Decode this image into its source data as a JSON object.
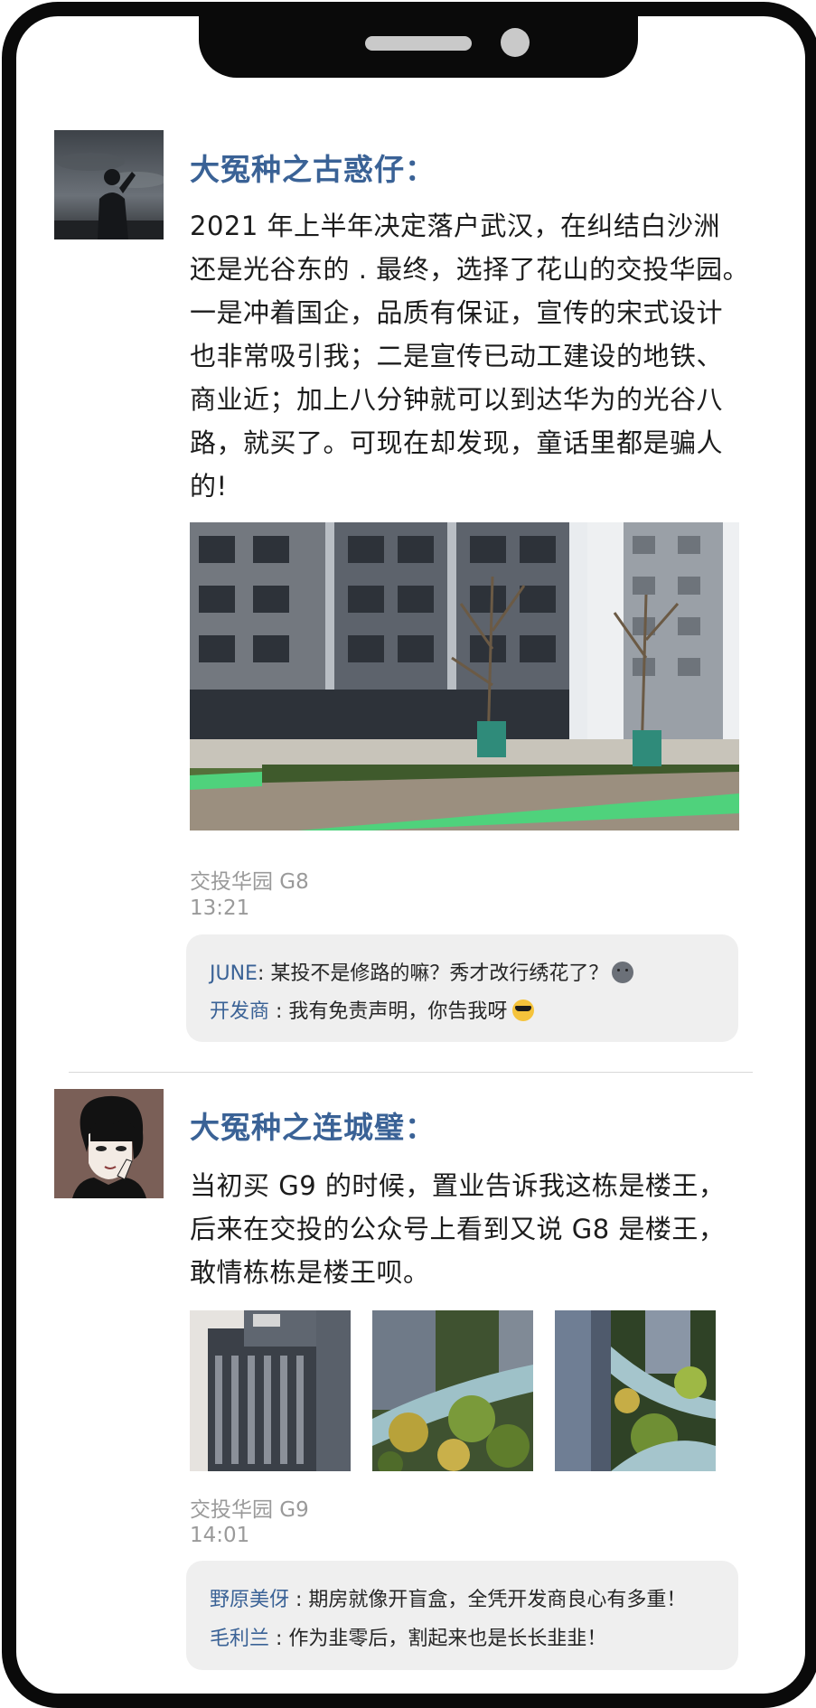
{
  "posts": [
    {
      "author": "大冤种之古惑仔：",
      "text_lines": [
        "2021 年上半年决定落户武汉，在纠结白沙洲",
        "还是光谷东的 . 最终，选择了花山的交投华园。",
        "一是冲着国企，品质有保证，宣传的宋式设计",
        "也非常吸引我；二是宣传已动工建设的地铁、",
        "商业近；加上八分钟就可以到达华为的光谷八",
        "路，就买了。可现在却发现，童话里都是骗人",
        "的!"
      ],
      "location": "交投华园 G8",
      "time": "13:21",
      "comments": [
        {
          "name": "JUNE",
          "sep": ": ",
          "text": "某投不是修路的嘛？秀才改行绣花了？",
          "emoji": "sad-face-icon"
        },
        {
          "name": "开发商",
          "sep": " : ",
          "text": "我有免责声明，你告我呀",
          "emoji": "sunglasses-face-icon"
        }
      ]
    },
    {
      "author": "大冤种之连城璧：",
      "text_lines": [
        "当初买 G9 的时候，置业告诉我这栋是楼王，",
        "后来在交投的公众号上看到又说 G8 是楼王，",
        "敢情栋栋是楼王呗。"
      ],
      "location": "交投华园 G9",
      "time": "14:01",
      "comments": [
        {
          "name": "野原美伢",
          "sep": " : ",
          "text": "期房就像开盲盒，全凭开发商良心有多重！"
        },
        {
          "name": "毛利兰",
          "sep": " : ",
          "text": "作为韭零后，割起来也是长长韭韭！"
        }
      ]
    }
  ],
  "colors": {
    "author": "#3a6296",
    "comment_name": "#3a6296",
    "meta": "#9a9a9a",
    "comment_bg": "#efefef",
    "frame": "#0a0a0a"
  }
}
